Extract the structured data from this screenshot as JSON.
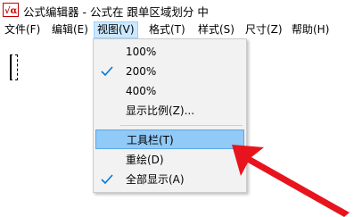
{
  "window": {
    "title": "公式编辑器 - 公式在 跟单区域划分 中",
    "icon": "equation-editor-app-icon"
  },
  "menubar": {
    "items": [
      {
        "label": "文件(F)"
      },
      {
        "label": "编辑(E)"
      },
      {
        "label": "视图(V)",
        "open": true
      },
      {
        "label": "格式(T)"
      },
      {
        "label": "样式(S)"
      },
      {
        "label": "尺寸(Z)"
      },
      {
        "label": "帮助(H)"
      }
    ]
  },
  "view_menu": {
    "items": [
      {
        "label": "100%",
        "checked": false
      },
      {
        "label": "200%",
        "checked": true
      },
      {
        "label": "400%",
        "checked": false
      },
      {
        "label": "显示比例(Z)...",
        "checked": false
      },
      {
        "label": "工具栏(T)",
        "checked": false,
        "highlighted": true
      },
      {
        "label": "重绘(D)",
        "checked": false
      },
      {
        "label": "全部显示(A)",
        "checked": true
      }
    ]
  },
  "colors": {
    "menu_open_bg": "#cce8ff",
    "highlight_bg": "#91c9f7",
    "check_color": "#0078d7",
    "arrow_color": "#e8141d"
  }
}
